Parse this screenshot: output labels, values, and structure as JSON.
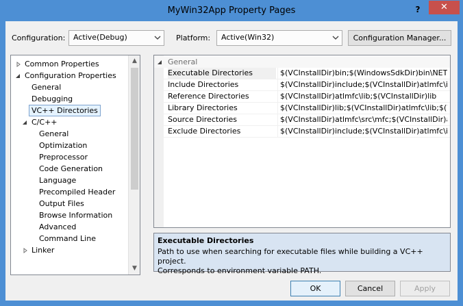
{
  "window": {
    "title": "MyWin32App Property Pages",
    "help_label": "?",
    "close_label": "✕"
  },
  "top": {
    "configuration_label": "Configuration:",
    "configuration_value": "Active(Debug)",
    "platform_label": "Platform:",
    "platform_value": "Active(Win32)",
    "config_manager_label": "Configuration Manager..."
  },
  "tree": {
    "items": [
      {
        "label": "Common Properties"
      },
      {
        "label": "Configuration Properties"
      },
      {
        "label": "General"
      },
      {
        "label": "Debugging"
      },
      {
        "label": "VC++ Directories"
      },
      {
        "label": "C/C++"
      },
      {
        "label": "General"
      },
      {
        "label": "Optimization"
      },
      {
        "label": "Preprocessor"
      },
      {
        "label": "Code Generation"
      },
      {
        "label": "Language"
      },
      {
        "label": "Precompiled Header"
      },
      {
        "label": "Output Files"
      },
      {
        "label": "Browse Information"
      },
      {
        "label": "Advanced"
      },
      {
        "label": "Command Line"
      },
      {
        "label": "Linker"
      }
    ]
  },
  "grid": {
    "category": "General",
    "rows": [
      {
        "name": "Executable Directories",
        "value": "$(VCInstallDir)bin;$(WindowsSdkDir)bin\\NET..."
      },
      {
        "name": "Include Directories",
        "value": "$(VCInstallDir)include;$(VCInstallDir)atlmfc\\in..."
      },
      {
        "name": "Reference Directories",
        "value": "$(VCInstallDir)atlmfc\\lib;$(VCInstallDir)lib"
      },
      {
        "name": "Library Directories",
        "value": "$(VCInstallDir)lib;$(VCInstallDir)atlmfc\\lib;$(Wi..."
      },
      {
        "name": "Source Directories",
        "value": "$(VCInstallDir)atlmfc\\src\\mfc;$(VCInstallDir)atlm..."
      },
      {
        "name": "Exclude Directories",
        "value": "$(VCInstallDir)include;$(VCInstallDir)atlmfc\\in..."
      }
    ]
  },
  "description": {
    "title": "Executable Directories",
    "line1": "Path to use when searching for executable files while building a VC++ project.",
    "line2": "Corresponds to environment variable PATH."
  },
  "buttons": {
    "ok": "OK",
    "cancel": "Cancel",
    "apply": "Apply"
  },
  "colors": {
    "title_bar": "#4d8fd4",
    "close_button": "#c7504c",
    "selection_border": "#7da2ce",
    "description_background": "#d8e4f2"
  }
}
